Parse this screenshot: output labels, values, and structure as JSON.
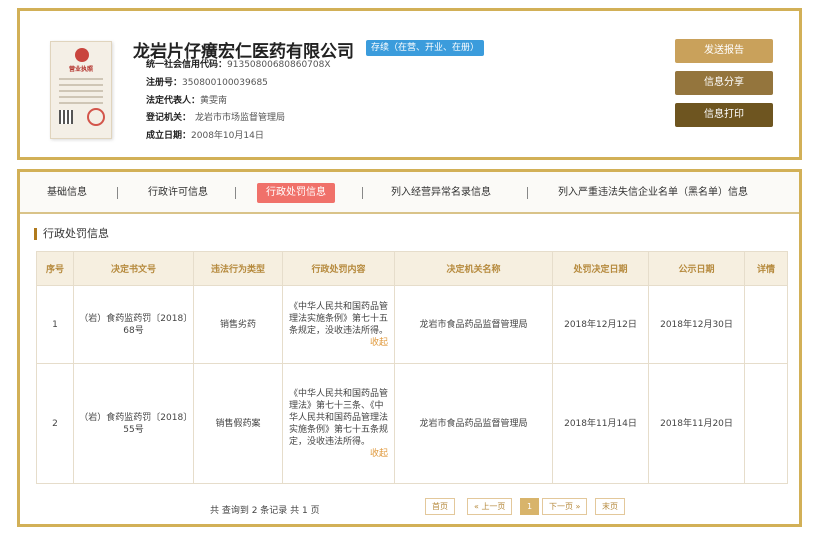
{
  "company": {
    "name": "龙岩片仔癀宏仁医药有限公司",
    "status": "存续（在营、开业、在册）",
    "license_title": "营业执照",
    "fields": [
      {
        "label": "统一社会信用代码：",
        "value": "91350800680860708X"
      },
      {
        "label": "注册号：",
        "value": "350800100039685"
      },
      {
        "label": "法定代表人：",
        "value": "黄雯南"
      },
      {
        "label": "登记机关：",
        "value": "龙岩市市场监督管理局"
      },
      {
        "label": "成立日期：",
        "value": "2008年10月14日"
      }
    ]
  },
  "actions": {
    "send_report": "发送报告",
    "share": "信息分享",
    "print": "信息打印"
  },
  "tabs": [
    {
      "label": "基础信息",
      "active": false
    },
    {
      "label": "行政许可信息",
      "active": false
    },
    {
      "label": "行政处罚信息",
      "active": true
    },
    {
      "label": "列入经营异常名录信息",
      "active": false
    },
    {
      "label": "列入严重违法失信企业名单（黑名单）信息",
      "active": false
    }
  ],
  "section_title": "行政处罚信息",
  "table": {
    "headers": [
      "序号",
      "决定书文号",
      "违法行为类型",
      "行政处罚内容",
      "决定机关名称",
      "处罚决定日期",
      "公示日期",
      "详情"
    ],
    "rows": [
      {
        "no": "1",
        "doc_no": "（岩）食药监药罚〔2018〕68号",
        "type": "销售劣药",
        "content": "《中华人民共和国药品管理法实施条例》第七十五条规定，没收违法所得。",
        "collapse": "收起",
        "authority": "龙岩市食品药品监督管理局",
        "decision_date": "2018年12月12日",
        "publish_date": "2018年12月30日",
        "detail": ""
      },
      {
        "no": "2",
        "doc_no": "（岩）食药监药罚〔2018〕55号",
        "type": "销售假药案",
        "content": "《中华人民共和国药品管理法》第七十三条、《中华人民共和国药品管理法实施条例》第七十五条规定，没收违法所得。",
        "collapse": "收起",
        "authority": "龙岩市食品药品监督管理局",
        "decision_date": "2018年11月14日",
        "publish_date": "2018年11月20日",
        "detail": ""
      }
    ]
  },
  "pagination": {
    "summary": "共 查询到 2 条记录 共 1 页",
    "first": "首页",
    "prev": "« 上一页",
    "current": "1",
    "next": "下一页 »",
    "last": "末页"
  }
}
